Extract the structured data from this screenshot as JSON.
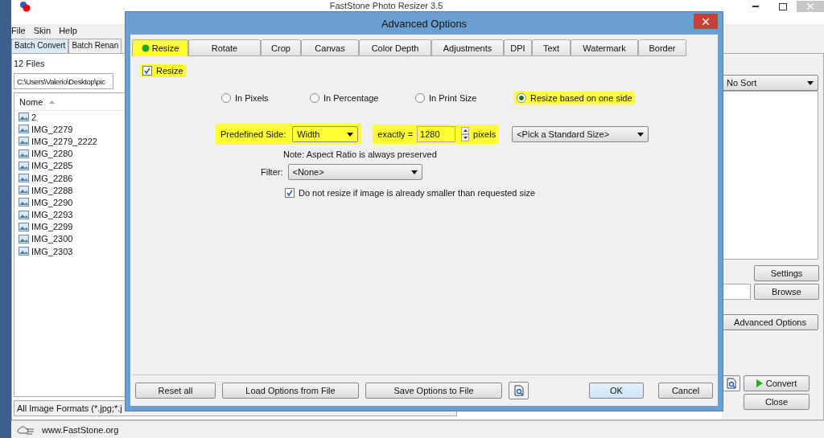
{
  "main_window": {
    "title": "FastStone Photo Resizer 3.5",
    "menu": [
      "File",
      "Skin",
      "Help"
    ],
    "tabs": [
      {
        "label": "Batch Convert",
        "selected": true
      },
      {
        "label": "Batch Renan",
        "selected": false
      }
    ],
    "file_count": "12 Files",
    "path": "C:\\Users\\Valerio\\Desktop\\pic",
    "list_header": "Nome",
    "files": [
      "2",
      "IMG_2279",
      "IMG_2279_2222",
      "IMG_2280",
      "IMG_2285",
      "IMG_2286",
      "IMG_2288",
      "IMG_2290",
      "IMG_2293",
      "IMG_2299",
      "IMG_2300",
      "IMG_2303"
    ],
    "format_filter": "All Image Formats (*.jpg;*.j",
    "sort": "No Sort",
    "buttons": {
      "settings": "Settings",
      "browse": "Browse",
      "advanced": "Advanced Options",
      "convert": "Convert",
      "close": "Close"
    },
    "status_bar": "www.FastStone.org"
  },
  "dialog": {
    "title": "Advanced Options",
    "tabs": [
      {
        "label": "Resize",
        "selected": true,
        "highlighted": true
      },
      {
        "label": "Rotate",
        "selected": false,
        "highlighted": false
      },
      {
        "label": "Crop",
        "selected": false,
        "highlighted": false
      },
      {
        "label": "Canvas",
        "selected": false,
        "highlighted": false
      },
      {
        "label": "Color Depth",
        "selected": false,
        "highlighted": false
      },
      {
        "label": "Adjustments",
        "selected": false,
        "highlighted": false
      },
      {
        "label": "DPI",
        "selected": false,
        "highlighted": false
      },
      {
        "label": "Text",
        "selected": false,
        "highlighted": false
      },
      {
        "label": "Watermark",
        "selected": false,
        "highlighted": false
      },
      {
        "label": "Border",
        "selected": false,
        "highlighted": false
      }
    ],
    "resize_checkbox": {
      "label": "Resize",
      "checked": true,
      "highlighted": true
    },
    "modes": [
      {
        "label": "In Pixels",
        "selected": false,
        "highlighted": false
      },
      {
        "label": "In Percentage",
        "selected": false,
        "highlighted": false
      },
      {
        "label": "In Print Size",
        "selected": false,
        "highlighted": false
      },
      {
        "label": "Resize based on one side",
        "selected": true,
        "highlighted": true
      }
    ],
    "predefined_side": {
      "label": "Predefined Side:",
      "value": "Width"
    },
    "exactly": {
      "label": "exactly =",
      "value": "1280",
      "unit": "pixels"
    },
    "standard_size": "<Pick a Standard Size>",
    "note": "Note: Aspect Ratio is always preserved",
    "filter": {
      "label": "Filter:",
      "value": "<None>"
    },
    "no_enlarge": {
      "label": "Do not resize if image is already smaller than requested size",
      "checked": true
    },
    "buttons": {
      "reset": "Reset all",
      "load": "Load Options from File",
      "save": "Save Options to File",
      "ok": "OK",
      "cancel": "Cancel"
    }
  }
}
